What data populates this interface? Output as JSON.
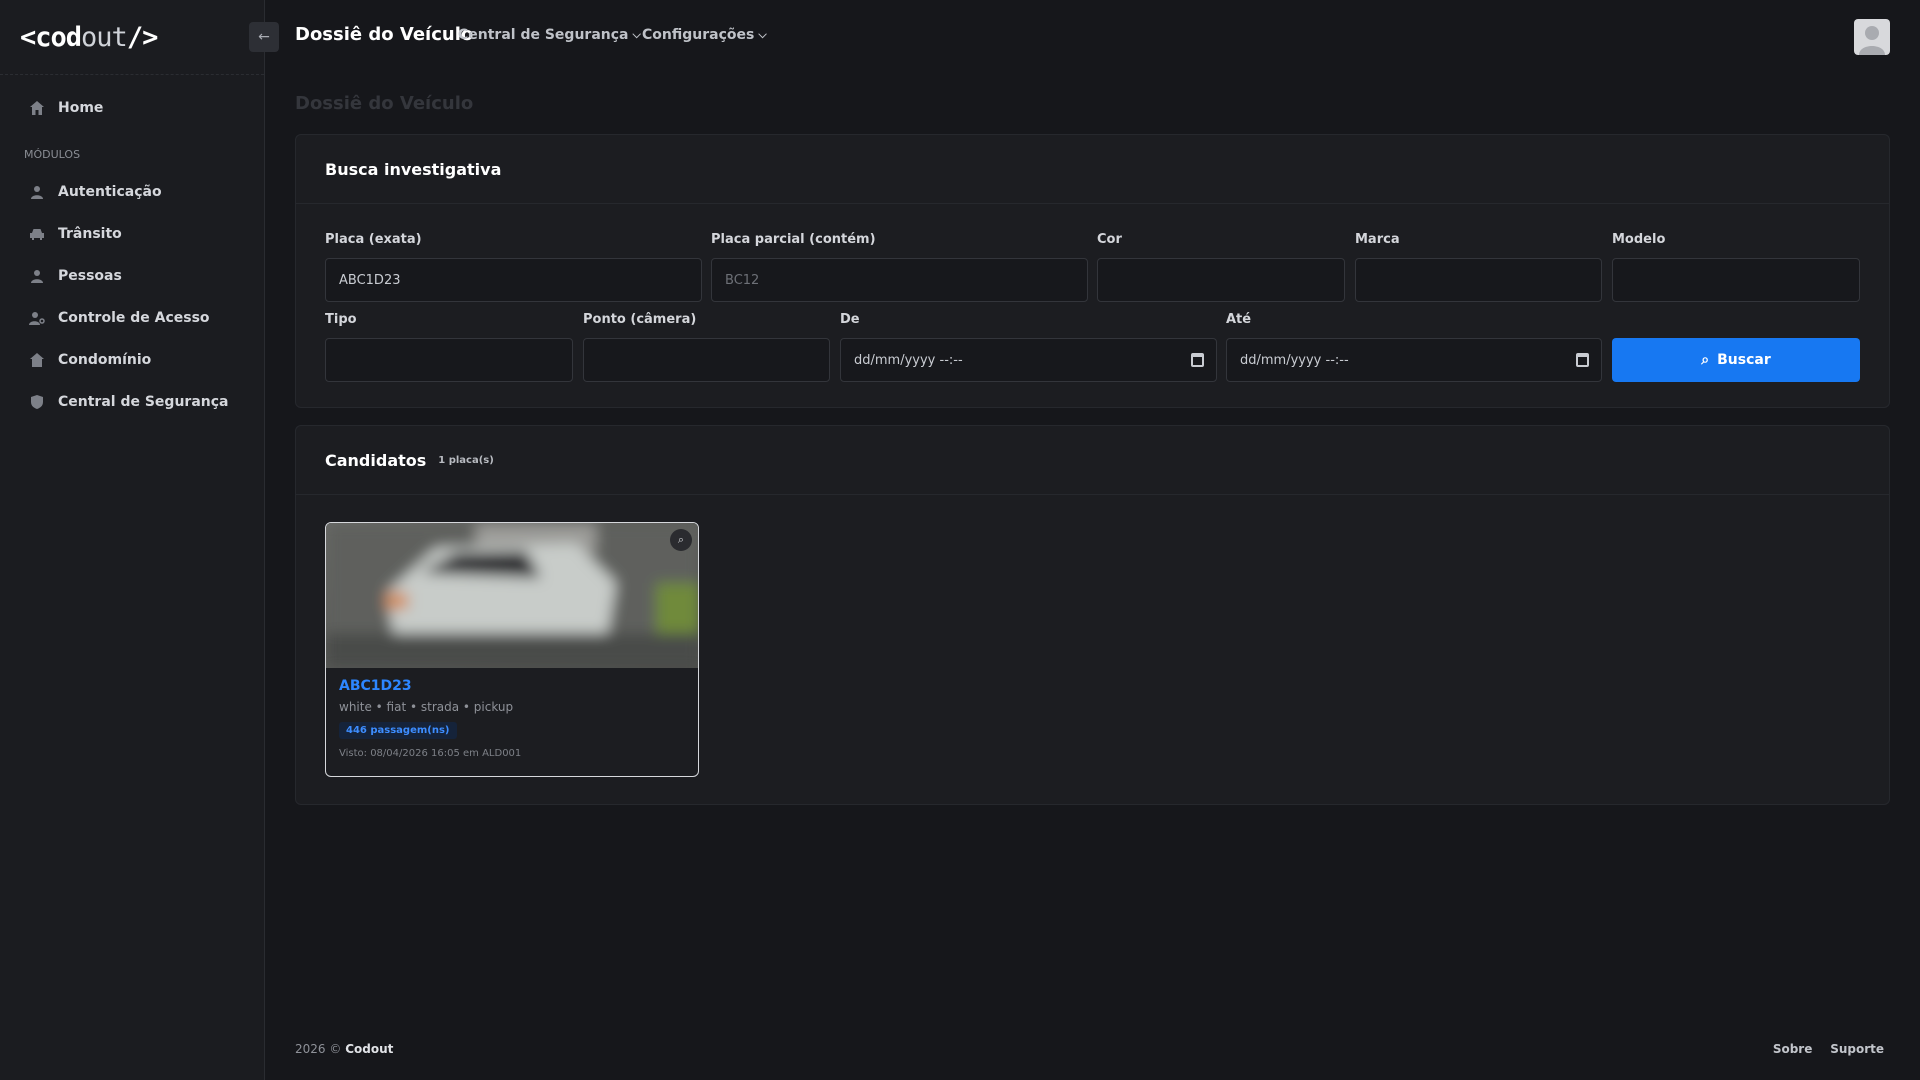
{
  "brand": {
    "logo_main": "<cod",
    "logo_out": "out",
    "logo_end": "/>"
  },
  "sidebar": {
    "items_top": [
      {
        "label": "Home",
        "icon": "home-icon"
      }
    ],
    "section_label": "MÓDULOS",
    "items": [
      {
        "label": "Autenticação",
        "icon": "user-icon"
      },
      {
        "label": "Trânsito",
        "icon": "car-icon"
      },
      {
        "label": "Pessoas",
        "icon": "person-icon"
      },
      {
        "label": "Controle de Acesso",
        "icon": "user-key-icon"
      },
      {
        "label": "Condomínio",
        "icon": "building-icon"
      },
      {
        "label": "Central de Segurança",
        "icon": "shield-icon"
      }
    ]
  },
  "header": {
    "back_icon": "←",
    "title": "Dossiê do Veículo",
    "menus": [
      {
        "label": "Central de Segurança",
        "chevron": "⌵"
      },
      {
        "label": "Configurações",
        "chevron": "⌵"
      }
    ]
  },
  "page": {
    "title": "Dossiê do Veículo"
  },
  "search": {
    "title": "Busca investigativa",
    "labels": {
      "placa_exata": "Placa (exata)",
      "placa_parcial": "Placa parcial (contém)",
      "cor": "Cor",
      "marca": "Marca",
      "modelo": "Modelo",
      "tipo": "Tipo",
      "ponto": "Ponto (câmera)",
      "de": "De",
      "ate": "Até"
    },
    "values": {
      "placa_exata": "ABC1D23",
      "placa_parcial_placeholder": "BC12",
      "de_placeholder": "dd/mm/yyyy --:--",
      "ate_placeholder": "dd/mm/yyyy --:--"
    },
    "button_label": "Buscar",
    "button_icon": "⌕"
  },
  "candidates": {
    "title": "Candidatos",
    "count": "1 placa(s)",
    "items": [
      {
        "plate": "ABC1D23",
        "meta": "white • fiat • strada • pickup",
        "passes": "446 passagem(ns)",
        "seen": "Visto: 08/04/2026 16:05 em ALD001",
        "zoom_icon": "⌕"
      }
    ]
  },
  "footer": {
    "year": "2026 ©",
    "company": "Codout",
    "links": [
      "Sobre",
      "Suporte"
    ]
  },
  "colors": {
    "primary": "#1778f2",
    "link": "#2d86ff",
    "bg": "#16171b",
    "card": "#1c1d21"
  }
}
